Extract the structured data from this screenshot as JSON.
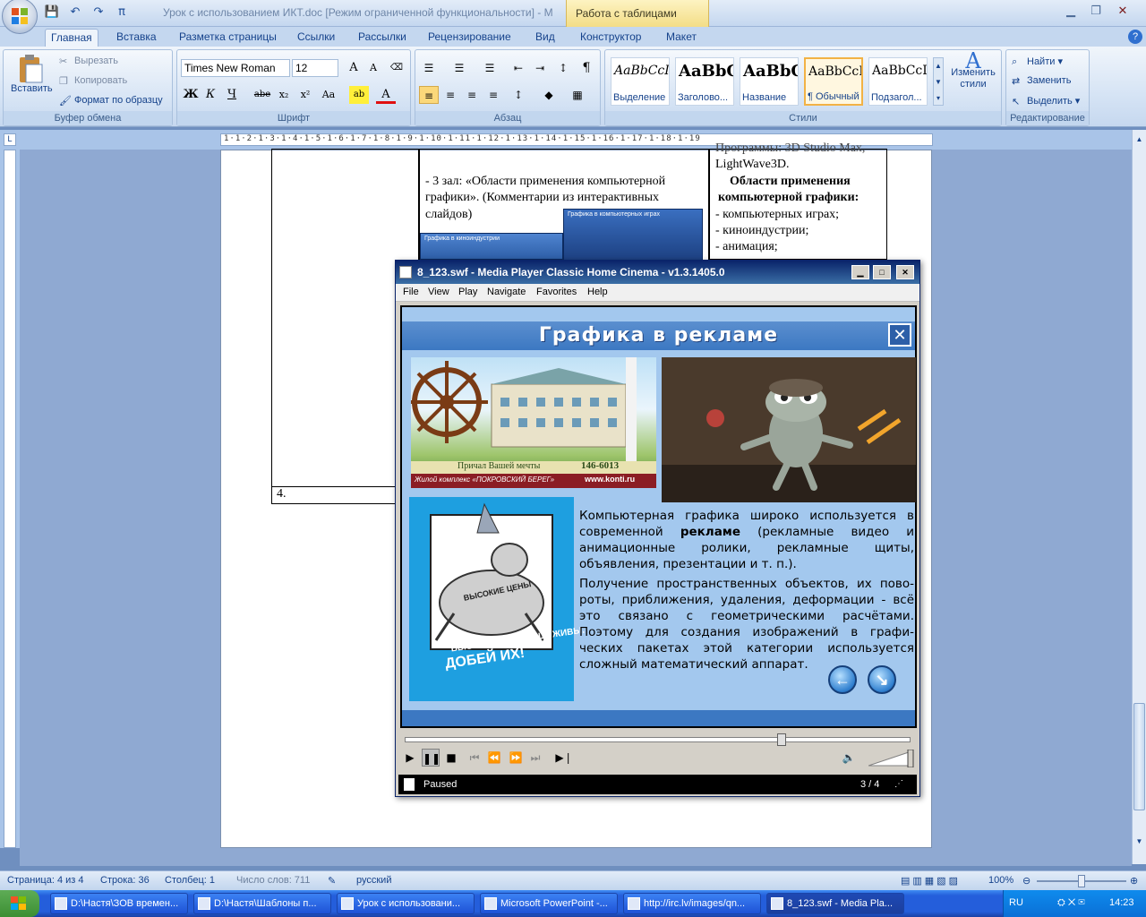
{
  "window": {
    "title": "Урок с использованием ИКТ.doc [Режим ограниченной функциональности] - M",
    "context_tab": "Работа с таблицами",
    "qat": [
      "💾",
      "↶",
      "↷",
      "π"
    ]
  },
  "tabs": [
    "Главная",
    "Вставка",
    "Разметка страницы",
    "Ссылки",
    "Рассылки",
    "Рецензирование",
    "Вид",
    "Конструктор",
    "Макет"
  ],
  "ribbon": {
    "clipboard": {
      "paste": "Вставить",
      "cut": "Вырезать",
      "copy": "Копировать",
      "format_painter": "Формат по образцу",
      "label": "Буфер обмена"
    },
    "font": {
      "family": "Times New Roman",
      "size": "12",
      "label": "Шрифт",
      "buttons": [
        "Ж",
        "К",
        "Ч",
        "abe",
        "x₂",
        "x²",
        "Aa"
      ]
    },
    "paragraph": {
      "label": "Абзац"
    },
    "styles": {
      "label": "Стили",
      "items": [
        {
          "preview": "AaBbCcI",
          "name": "Выделение"
        },
        {
          "preview": "AaBbC",
          "name": "Заголово..."
        },
        {
          "preview": "AaBbC",
          "name": "Название"
        },
        {
          "preview": "AaBbCcI",
          "name": "¶ Обычный"
        },
        {
          "preview": "AaBbCcI",
          "name": "Подзагол..."
        }
      ],
      "change": "Изменить стили"
    },
    "editing": {
      "find": "Найти",
      "replace": "Заменить",
      "select": "Выделить",
      "label": "Редактирование"
    }
  },
  "ruler": {
    "h_text": "1·1·2·1·3·1·4·1·5·1·6·1·7·1·8·1·9·1·10·1·11·1·12·1·13·1·14·1·15·1·16·1·17·1·18·1·19"
  },
  "document": {
    "col2_text1": "- 3 зал: «Области применения компьютерной",
    "col2_text2": "графики». (Комментарии из интерактивных",
    "col2_text3": "слайдов)",
    "col3_text0": "Программы: 3D Studio Max,",
    "col3_text1": "LightWave3D.",
    "col3_text2": "Области применения",
    "col3_text3": "компьютерной графики:",
    "col3_text4": "- компьютерных играх;",
    "col3_text5": "- киноиндустрии;",
    "col3_text6": "- анимация;",
    "row_num": "4.",
    "thumb1": "Графика в киноиндустрии",
    "thumb2": "Графика в компьютерных играх"
  },
  "player": {
    "title": "8_123.swf - Media Player Classic Home Cinema - v1.3.1405.0",
    "menu": [
      "File",
      "View",
      "Play",
      "Navigate",
      "Favorites",
      "Help"
    ],
    "status": "Paused",
    "counter": "3 / 4",
    "seek_fraction": 0.75
  },
  "slide": {
    "title": "Графика в рекламе",
    "ad_caption": "Причал Вашей мечты",
    "ad_phone": "146-6013",
    "ad_complex": "Жилой комплекс «ПОКРОВСКИЙ БЕРЕГ»",
    "ad_site": "www.konti.ru",
    "cartoon_text1": "ВЫСОКИЕ ЦЕНЫ",
    "cartoon_text2": "ВЫСОКИЕ ЦЕНЫ ЕЩЕ ЖИВЫ.",
    "cartoon_text3": "ДОБЕЙ ИХ!",
    "para1_a": "Компьютерная графика широко используется в современной ",
    "para1_bold": "рекламе",
    "para1_b": " (рекламные видео и анимационные ролики, рекламные щиты, объявления, презентации и т. п.).",
    "para2": "Получение пространственных объектов, их пово-роты, приближения, удаления, деформации - всё это связано с геометрическими расчётами. Поэтому для создания изображений в графи-ческих пакетах этой категории используется сложный математический аппарат."
  },
  "statusbar": {
    "page": "Страница: 4 из 4",
    "line": "Строка: 36",
    "column": "Столбец: 1",
    "words": "Число слов: 711",
    "lang": "русский",
    "zoom": "100%"
  },
  "taskbar": {
    "tasks": [
      "D:\\Настя\\ЗОВ времен...",
      "D:\\Настя\\Шаблоны п...",
      "Урок с использовани...",
      "Microsoft PowerPoint -...",
      "http://irc.lv/images/qn...",
      "8_123.swf - Media Pla..."
    ],
    "lang": "RU",
    "clock": "14:23"
  }
}
